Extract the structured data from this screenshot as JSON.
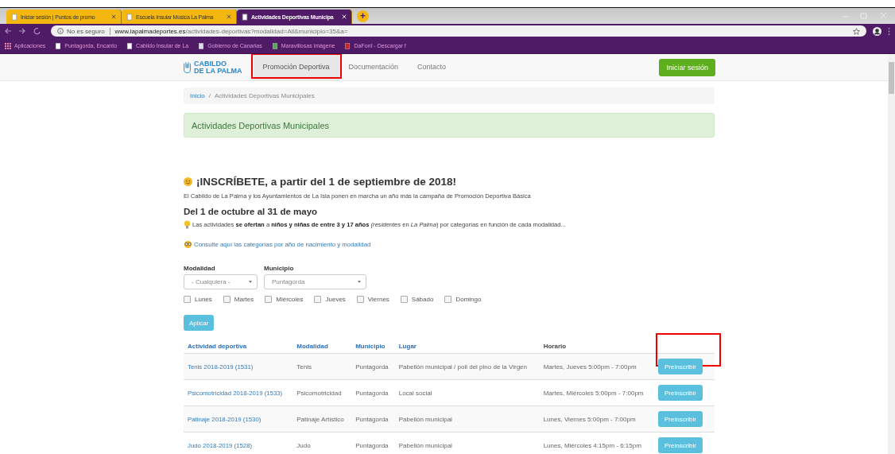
{
  "browser": {
    "tabs": [
      {
        "title": "Iniciar sesión | Puntos de promo",
        "selected": false
      },
      {
        "title": "Escuela Insular Música La Palma",
        "selected": false
      },
      {
        "title": "Actividades Deportivas Municipa",
        "selected": true
      }
    ],
    "new_tab": "+",
    "security": "No es seguro",
    "url_domain": "www.lapalmadeportes.es",
    "url_path": "/actividades-deportivas?modalidad=All&municipio=35&a=",
    "bookmarks": [
      "Aplicaciones",
      "Puntagorda, Encanto",
      "Cabildo Insular de La",
      "Gobierno de Canarias",
      "Maravillosas imágene",
      "DaFont - Descargar f"
    ]
  },
  "navbar": {
    "logo_line_1": "CABILDO",
    "logo_line_2": "DE LA PALMA",
    "items": [
      {
        "label": "Promoción Deportiva",
        "selected": true,
        "highlighted": true
      },
      {
        "label": "Documentación",
        "selected": false,
        "highlighted": false
      },
      {
        "label": "Contacto",
        "selected": false,
        "highlighted": false
      }
    ],
    "login": "Iniciar sesión"
  },
  "breadcrumb": [
    "Inicio",
    "/",
    "Actividades Deportivas Municipales"
  ],
  "alert": "Actividades Deportivas Municipales",
  "heading": "¡INSCRÍBETE, a partir del 1 de septiembre de 2018!",
  "intro": "El Cabildo de La Palma y los Ayuntamientos de La Isla ponen en marcha un año más la campaña de Promoción Deportiva Básica",
  "subheading": "Del 1 de octubre al 31 de mayo",
  "offer": "Las actividades **se ofertan** a **niños y niñas de entre 3 y 17 años** *(residentes* en *La Palma*) por categorías en función de cada modalidad...",
  "categories_link": "Consulte aquí las categorías por año de nacimiento y modalidad",
  "filters": {
    "selects": [
      {
        "label": "Modalidad",
        "value": "- Cualquiera -"
      },
      {
        "label": "Municipio",
        "value": "Puntagorda"
      }
    ],
    "days": [
      {
        "label": "Lunes",
        "checked": false
      },
      {
        "label": "Martes",
        "checked": false
      },
      {
        "label": "Miércoles",
        "checked": false
      },
      {
        "label": "Jueves",
        "checked": false
      },
      {
        "label": "Viernes",
        "checked": false
      },
      {
        "label": "Sábado",
        "checked": false
      },
      {
        "label": "Domingo",
        "checked": false
      }
    ],
    "apply": "Aplicar"
  },
  "table": {
    "columns": [
      {
        "label": "Actividad deportiva",
        "sortable": true
      },
      {
        "label": "Modalidad",
        "sortable": true
      },
      {
        "label": "Municipio",
        "sortable": true
      },
      {
        "label": "Lugar",
        "sortable": true
      },
      {
        "label": "Horario",
        "sortable": false
      }
    ],
    "action_column_highlighted": true,
    "rows": [
      {
        "activity": "Tenis 2018-2019 (1531)",
        "modality": "Tenis",
        "municipality": "Puntagorda",
        "place": "Pabellón municipal / poli del pino de la Virgen",
        "schedule": "Martes, Jueves 5:00pm - 7:00pm",
        "action": "Preinscribir"
      },
      {
        "activity": "Psicomotricidad 2018-2019 (1533)",
        "modality": "Psicomotricidad",
        "municipality": "Puntagorda",
        "place": "Local social",
        "schedule": "Martes, Miércoles 5:00pm - 7:00pm",
        "action": "Preinscribir"
      },
      {
        "activity": "Patinaje 2018-2019 (1530)",
        "modality": "Patinaje Artístico",
        "municipality": "Puntagorda",
        "place": "Pabellón municipal",
        "schedule": "Lunes, Viernes 5:00pm - 7:00pm",
        "action": "Preinscribir"
      },
      {
        "activity": "Judo 2018-2019 (1528)",
        "modality": "Judo",
        "municipality": "Puntagorda",
        "place": "Pabellón municipal",
        "schedule": "Lunes, Miércoles 4:15pm - 6:15pm",
        "action": "Preinscribir"
      }
    ]
  }
}
